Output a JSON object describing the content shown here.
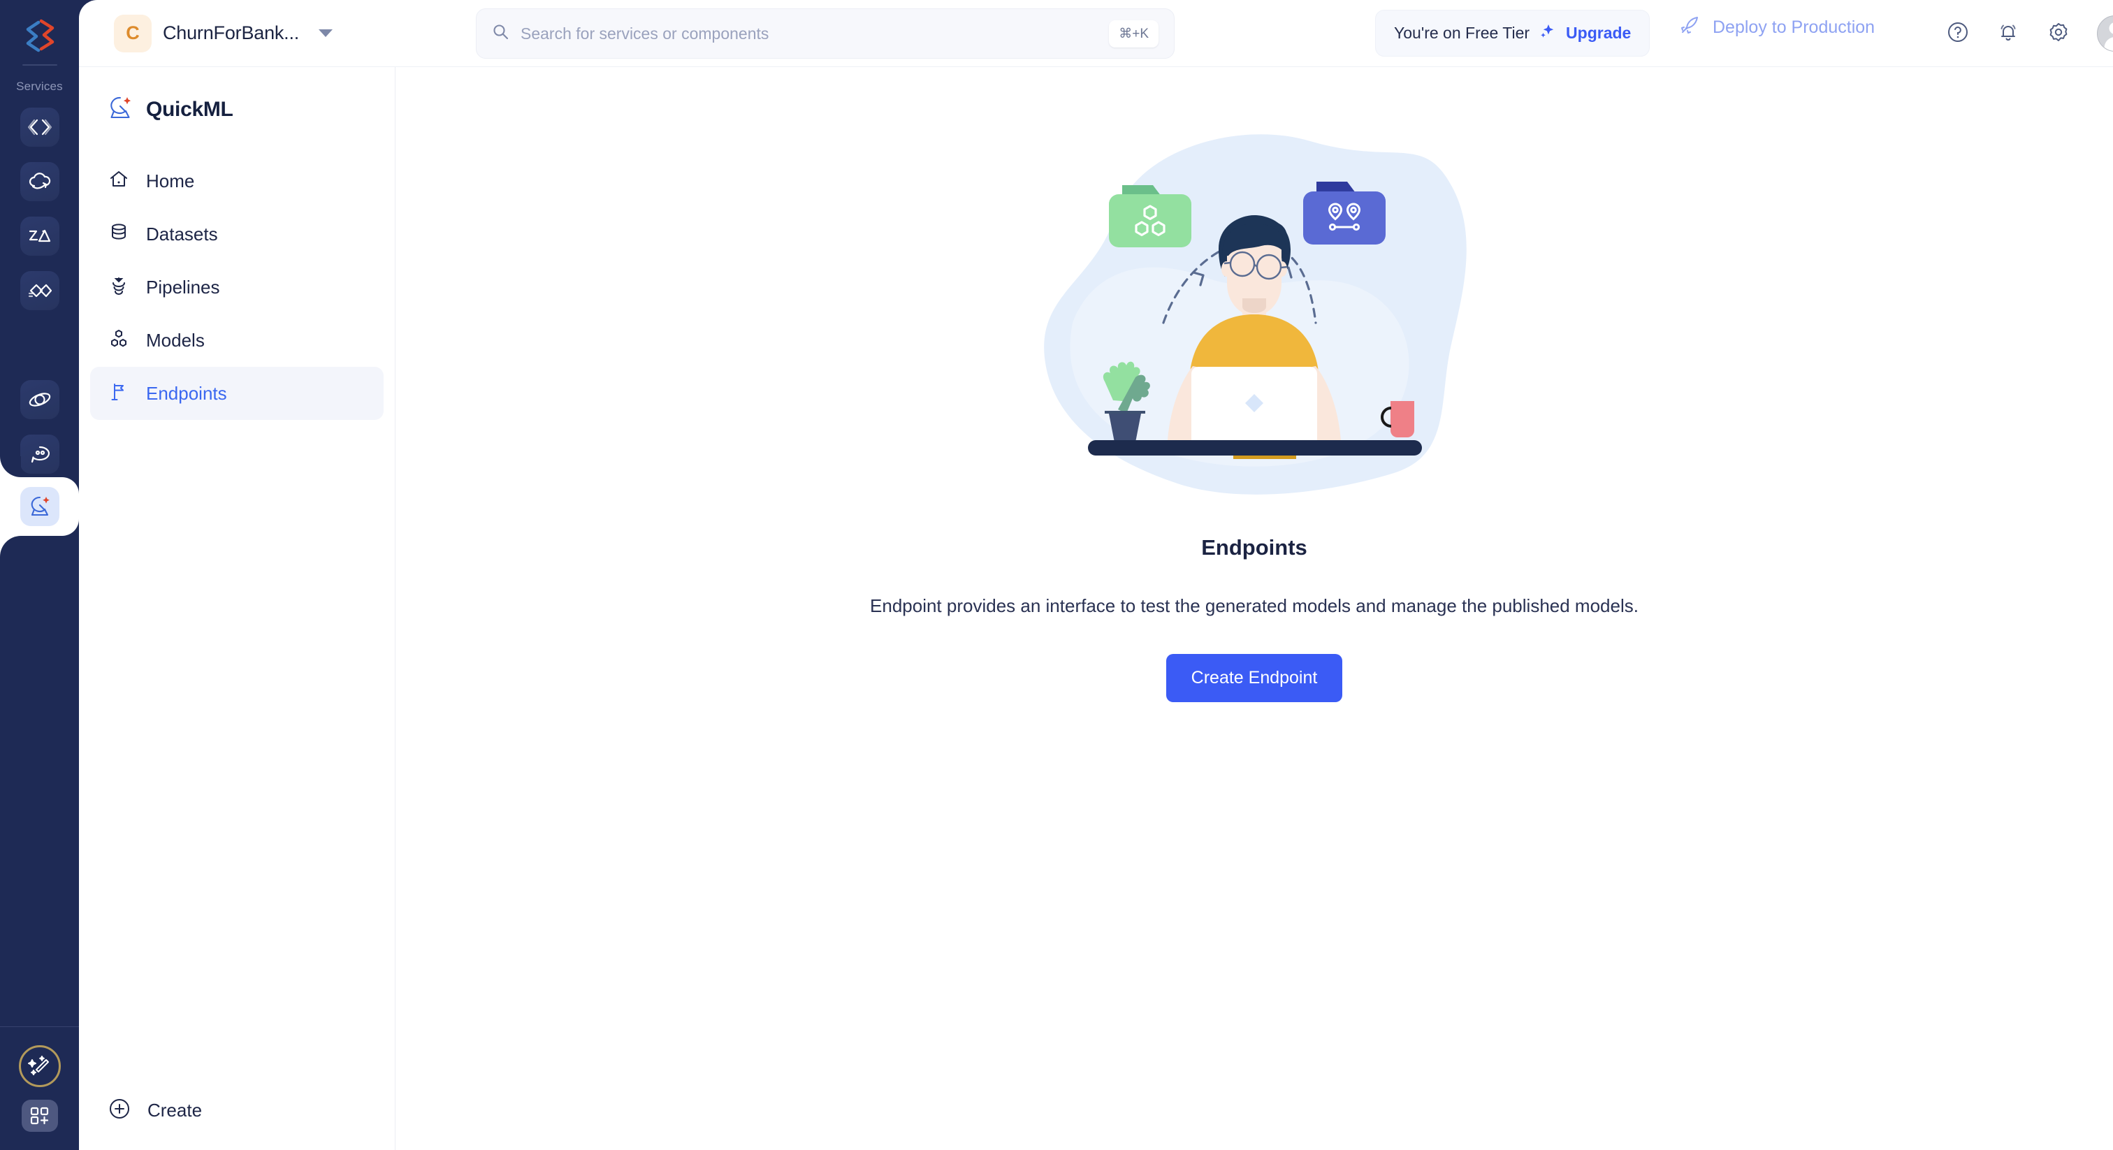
{
  "rail": {
    "logo_icon": "zoho-logo-icon",
    "services_label": "Services",
    "items": [
      {
        "icon": "code-brackets-icon",
        "name": "catalyst-code"
      },
      {
        "icon": "cloud-arrow-icon",
        "name": "cloud-scale"
      },
      {
        "icon": "image-stack-icon",
        "name": "media-service"
      },
      {
        "icon": "double-chevron-icon",
        "name": "signals-service"
      },
      {
        "icon": "quickml-sparkle-icon",
        "name": "quickml",
        "active": true
      },
      {
        "icon": "orbit-icon",
        "name": "orbit-service"
      },
      {
        "icon": "chat-bubble-icon",
        "name": "chat-service"
      }
    ],
    "magic_icon": "magic-wand-icon",
    "grid_add_icon": "grid-plus-icon"
  },
  "topbar": {
    "org_initial": "C",
    "org_name": "ChurnForBank...",
    "org_caret_icon": "chevron-down-icon",
    "search": {
      "icon": "search-icon",
      "placeholder": "Search for services or components",
      "value": "",
      "shortcut": "⌘+K"
    },
    "tier": {
      "text": "You're on Free Tier",
      "sparkle_icon": "sparkle-icon",
      "upgrade_label": "Upgrade"
    },
    "deploy": {
      "icon": "rocket-icon",
      "label": "Deploy to Production"
    },
    "icons": [
      {
        "icon": "help-circle-icon",
        "name": "help-button"
      },
      {
        "icon": "bell-icon",
        "name": "notifications-button"
      },
      {
        "icon": "gear-icon",
        "name": "settings-button"
      }
    ],
    "avatar_icon": "user-avatar"
  },
  "sidebar": {
    "brand_icon": "quickml-sparkle-icon",
    "brand_name": "QuickML",
    "items": [
      {
        "icon": "home-icon",
        "label": "Home",
        "active": false
      },
      {
        "icon": "database-icon",
        "label": "Datasets",
        "active": false
      },
      {
        "icon": "funnel-icon",
        "label": "Pipelines",
        "active": false
      },
      {
        "icon": "models-nodes-icon",
        "label": "Models",
        "active": false
      },
      {
        "icon": "flag-icon",
        "label": "Endpoints",
        "active": true
      }
    ],
    "create": {
      "icon": "plus-circle-icon",
      "label": "Create"
    }
  },
  "main": {
    "illustration_name": "endpoints-empty-state-illustration",
    "title": "Endpoints",
    "description": "Endpoint provides an interface to test the generated models and manage the published models.",
    "cta_label": "Create Endpoint"
  },
  "colors": {
    "rail_bg": "#1e2a55",
    "accent_blue": "#3b5bf5",
    "nav_active_bg": "#f3f5fb",
    "nav_active_text": "#3b68f0",
    "org_avatar_bg": "#fdf0e0",
    "org_avatar_text": "#dd8b2c",
    "deploy_text": "#8ea2f2",
    "illus_blob": "#e3edfa",
    "illus_folder_green": "#93e0a0",
    "illus_folder_blue": "#5a6ad4",
    "illus_shirt_yellow": "#f0b73c",
    "illus_desk": "#1d2b4d",
    "illus_mug": "#ef8087"
  }
}
